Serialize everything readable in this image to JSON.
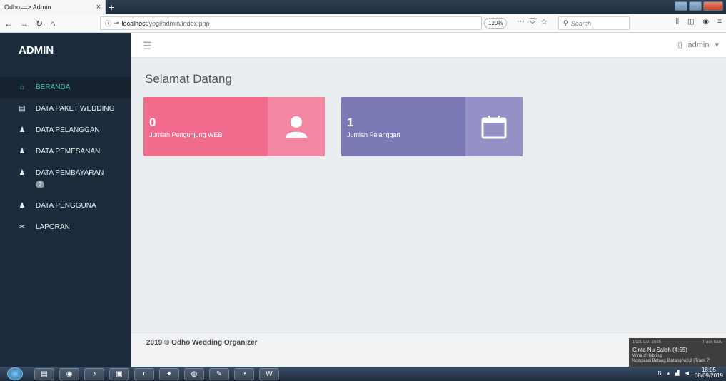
{
  "browser": {
    "tab_title": "Odho==> Admin",
    "tab_close": "×",
    "new_tab": "+",
    "nav_back": "←",
    "nav_forward": "→",
    "nav_reload": "↻",
    "nav_home": "⌂",
    "url_host": "localhost",
    "url_path": "/yogi/admin/index.php",
    "zoom": "120%",
    "more": "···",
    "search_placeholder": "Search"
  },
  "sidebar": {
    "brand": "ADMIN",
    "items": [
      {
        "label": "BERANDA",
        "icon": "home-icon",
        "glyph": "⌂"
      },
      {
        "label": "DATA PAKET WEDDING",
        "icon": "file-icon",
        "glyph": "▤"
      },
      {
        "label": "DATA PELANGGAN",
        "icon": "user-icon",
        "glyph": "♟"
      },
      {
        "label": "DATA PEMESANAN",
        "icon": "user-icon",
        "glyph": "♟"
      },
      {
        "label": "DATA PEMBAYARAN",
        "icon": "user-icon",
        "glyph": "♟",
        "badge": "2"
      },
      {
        "label": "DATA PENGGUNA",
        "icon": "user-icon",
        "glyph": "♟"
      },
      {
        "label": "LAPORAN",
        "icon": "tools-icon",
        "glyph": "✂"
      }
    ]
  },
  "topbar": {
    "user": "admin",
    "user_caret": "▾"
  },
  "main": {
    "title": "Selamat Datang",
    "cards": [
      {
        "value": "0",
        "label": "Jumlah Pengunjung WEB",
        "icon": "user-icon",
        "color": "#f06b8c"
      },
      {
        "value": "1",
        "label": "Jumlah Pelanggan",
        "icon": "calendar-icon",
        "color": "#7b79b6"
      }
    ]
  },
  "footer": {
    "text": "2019 © Odho Wedding Organizer"
  },
  "media": {
    "counter": "1021 dari 2825",
    "link": "Track baru",
    "song": "Cinta Nu Salah (4:55)",
    "artist": "Wina d'Hebring",
    "album": "Kompilasi Betang Bintang Vol.2 (Track 7)"
  },
  "taskbar": {
    "lang": "IN",
    "time": "18:05",
    "date": "08/09/2019"
  }
}
